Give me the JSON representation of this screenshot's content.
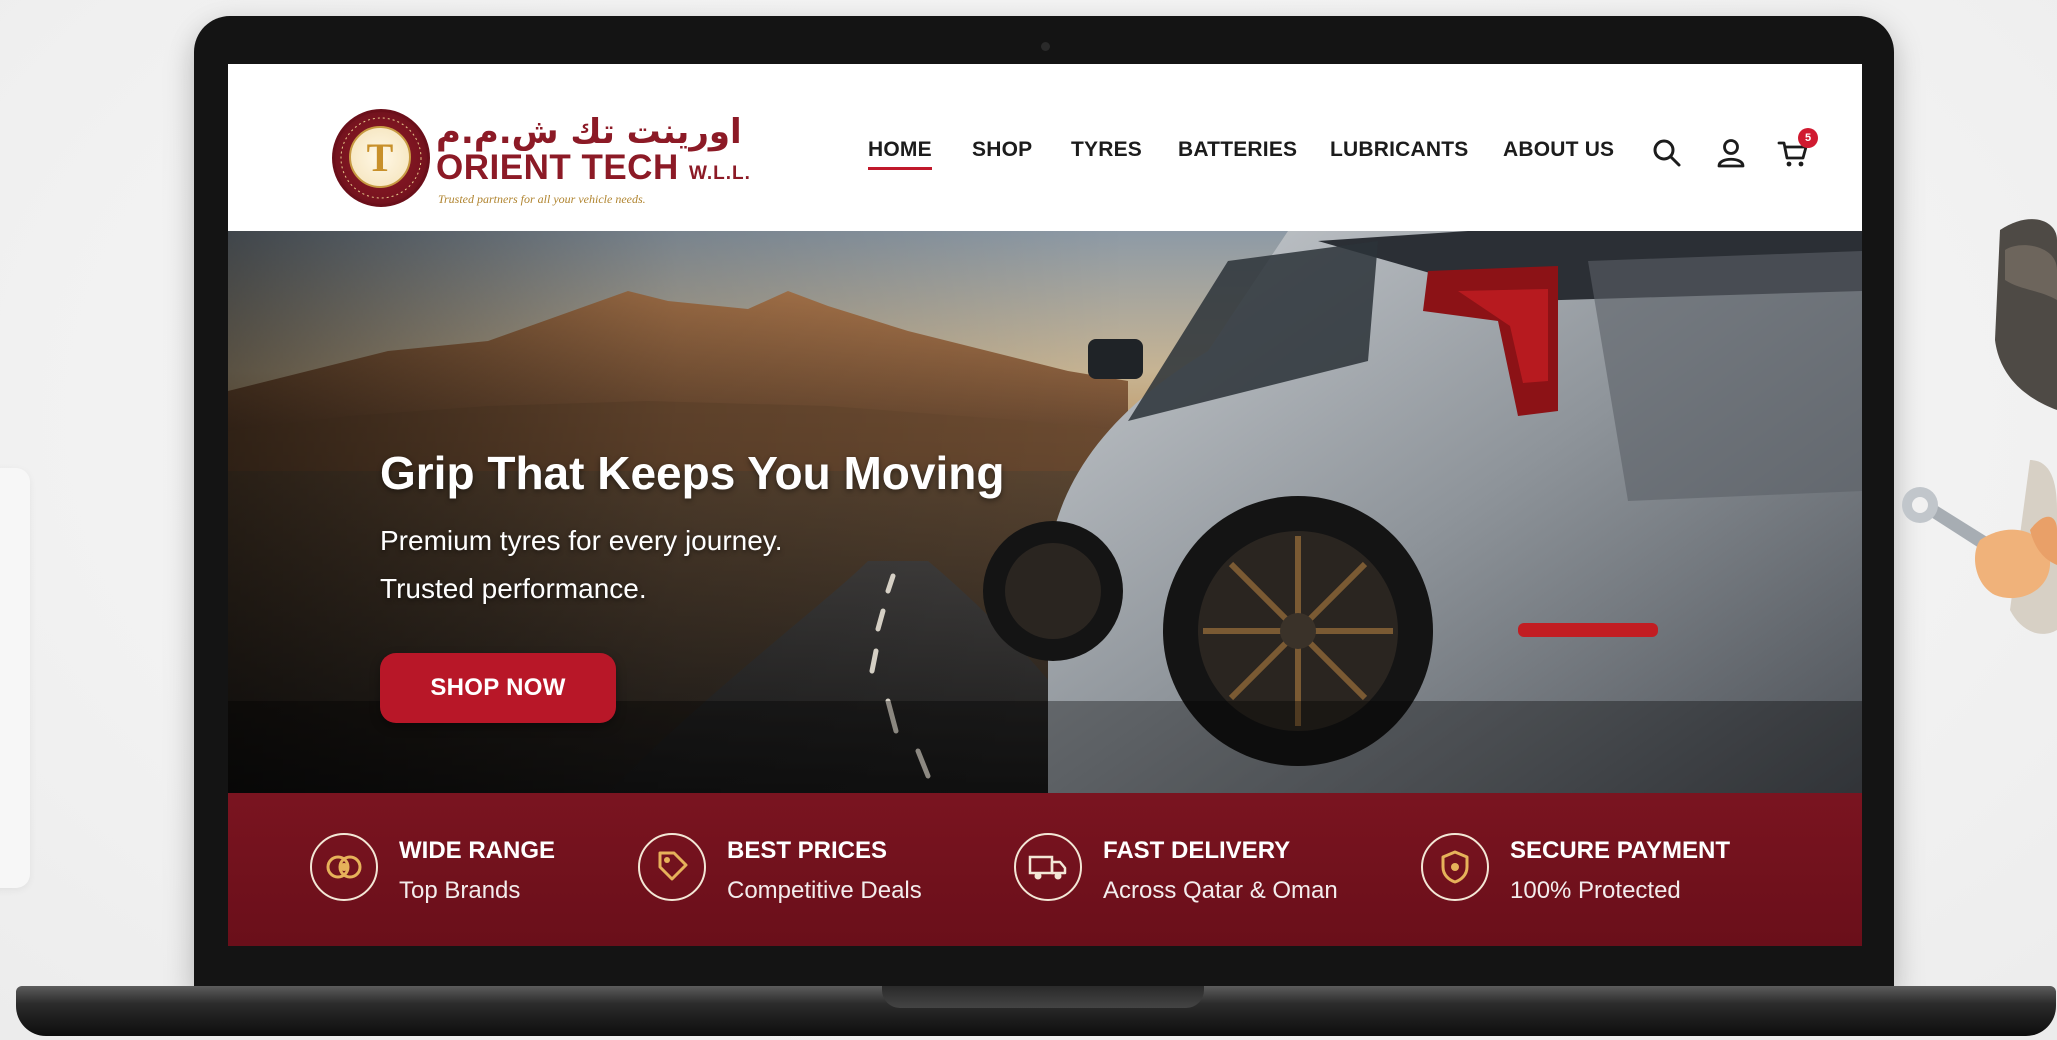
{
  "brand": {
    "arabic_name": "اورينت تك ش.م.م",
    "name": "ORIENT TECH",
    "suffix": "W.L.L.",
    "tagline": "Trusted partners for all your vehicle needs."
  },
  "nav": {
    "items": [
      {
        "label": "HOME",
        "active": true
      },
      {
        "label": "SHOP"
      },
      {
        "label": "TYRES"
      },
      {
        "label": "BATTERIES"
      },
      {
        "label": "LUBRICANTS"
      },
      {
        "label": "ABOUT US"
      }
    ],
    "cart_count": "5"
  },
  "hero": {
    "title": "Grip That Keeps You Moving",
    "subtitle_line1": "Premium tyres for every journey.",
    "subtitle_line2": "Trusted performance.",
    "cta": "SHOP NOW"
  },
  "features": [
    {
      "title": "WIDE RANGE",
      "subtitle": "Top Brands",
      "icon": "tyres-icon"
    },
    {
      "title": "BEST PRICES",
      "subtitle": "Competitive Deals",
      "icon": "price-tag-icon"
    },
    {
      "title": "FAST DELIVERY",
      "subtitle": "Across Qatar & Oman",
      "icon": "delivery-truck-icon"
    },
    {
      "title": "SECURE PAYMENT",
      "subtitle": "100% Protected",
      "icon": "secure-shield-icon"
    }
  ],
  "colors": {
    "brand_maroon": "#7a1420",
    "cta_red": "#b81728",
    "badge_red": "#d01a30",
    "gold": "#c8902a"
  }
}
